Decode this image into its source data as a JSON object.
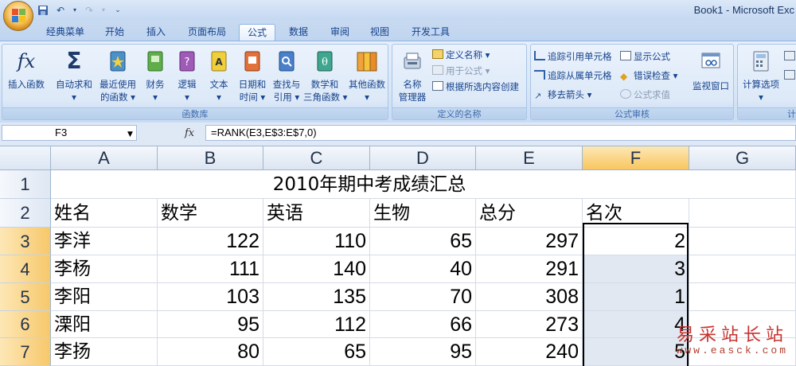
{
  "window": {
    "title": "Book1 - Microsoft Exc"
  },
  "tabs": [
    "经典菜单",
    "开始",
    "插入",
    "页面布局",
    "公式",
    "数据",
    "审阅",
    "视图",
    "开发工具"
  ],
  "active_tab": "公式",
  "ribbon": {
    "function_library": {
      "label": "函数库",
      "buttons": [
        {
          "label1": "插入函数",
          "label2": "",
          "icon": "fx-icon"
        },
        {
          "label1": "自动求和",
          "label2": "▾",
          "icon": "sigma-icon"
        },
        {
          "label1": "最近使用",
          "label2": "的函数 ▾",
          "icon": "star-book-icon"
        },
        {
          "label1": "财务",
          "label2": "▾",
          "icon": "finance-book-icon"
        },
        {
          "label1": "逻辑",
          "label2": "▾",
          "icon": "logic-book-icon"
        },
        {
          "label1": "文本",
          "label2": "▾",
          "icon": "text-book-icon"
        },
        {
          "label1": "日期和",
          "label2": "时间 ▾",
          "icon": "date-book-icon"
        },
        {
          "label1": "查找与",
          "label2": "引用 ▾",
          "icon": "lookup-book-icon"
        },
        {
          "label1": "数学和",
          "label2": "三角函数 ▾",
          "icon": "math-book-icon"
        },
        {
          "label1": "其他函数",
          "label2": "▾",
          "icon": "more-books-icon"
        }
      ]
    },
    "defined_names": {
      "label": "定义的名称",
      "name_manager_1": "名称",
      "name_manager_2": "管理器",
      "define_name": "定义名称 ▾",
      "use_in_formula": "用于公式 ▾",
      "create_from_selection": "根据所选内容创建"
    },
    "formula_auditing": {
      "label": "公式审核",
      "trace_precedents": "追踪引用单元格",
      "trace_dependents": "追踪从属单元格",
      "remove_arrows": "移去箭头 ▾",
      "show_formulas": "显示公式",
      "error_checking": "错误检查 ▾",
      "evaluate_formula": "公式求值",
      "watch_window": "监视窗口"
    },
    "calculation": {
      "label": "计",
      "calc_options_1": "计算选项",
      "calc_options_2": "▾"
    }
  },
  "formula_bar": {
    "name_box": "F3",
    "fx": "fx",
    "formula": "=RANK(E3,E$3:E$7,0)"
  },
  "sheet": {
    "columns": [
      "A",
      "B",
      "C",
      "D",
      "E",
      "F",
      "G"
    ],
    "selected_column": "F",
    "rows": [
      "1",
      "2",
      "3",
      "4",
      "5",
      "6",
      "7"
    ],
    "title": "2010年期中考成绩汇总",
    "headers": [
      "姓名",
      "数学",
      "英语",
      "生物",
      "总分",
      "名次"
    ],
    "data": [
      {
        "name": "李洋",
        "math": "122",
        "english": "110",
        "biology": "65",
        "total": "297",
        "rank": "2"
      },
      {
        "name": "李杨",
        "math": "111",
        "english": "140",
        "biology": "40",
        "total": "291",
        "rank": "3"
      },
      {
        "name": "李阳",
        "math": "103",
        "english": "135",
        "biology": "70",
        "total": "308",
        "rank": "1"
      },
      {
        "name": "溧阳",
        "math": "95",
        "english": "112",
        "biology": "66",
        "total": "273",
        "rank": "4"
      },
      {
        "name": "李扬",
        "math": "80",
        "english": "65",
        "biology": "95",
        "total": "240",
        "rank": "5"
      }
    ]
  },
  "watermark": {
    "line1": "易采站长站",
    "line2": "www.easck.com"
  },
  "colors": {
    "ribbon": "#dbe7f7",
    "selected_header": "#f8c65f",
    "grid_line": "#d4dbe6"
  }
}
